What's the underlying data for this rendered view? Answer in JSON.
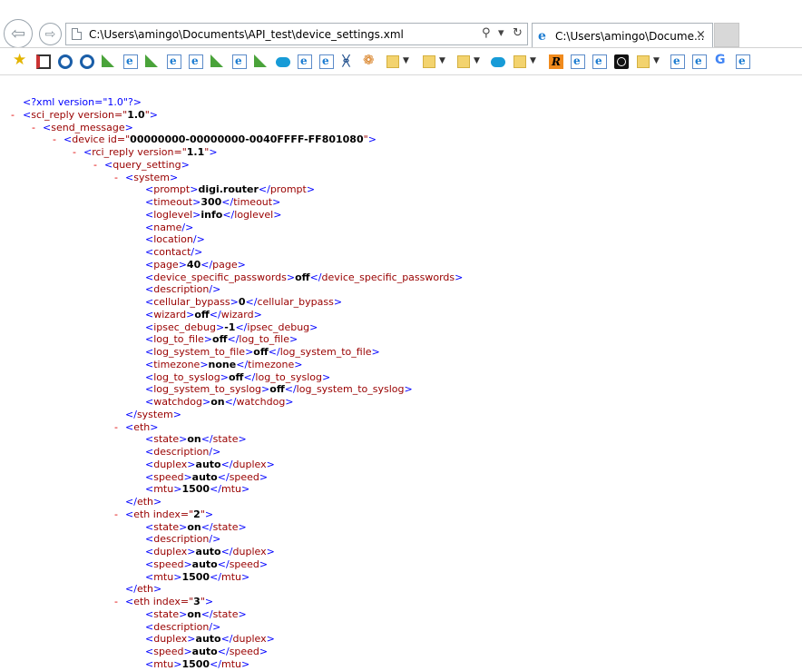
{
  "browser": {
    "address": "C:\\Users\\amingo\\Documents\\API_test\\device_settings.xml",
    "tab_title": "C:\\Users\\amingo\\Docume...",
    "tab_close": "×",
    "search_icon": "⚲",
    "dropdown_icon": "▾",
    "refresh_icon": "↻"
  },
  "favorites_bar": {
    "icons": [
      "star-icon",
      "books-icon",
      "ring-icon",
      "ring-icon",
      "green-flag-icon",
      "ie-page-icon",
      "green-flag-icon",
      "ie-page-icon",
      "ie-page-icon",
      "green-flag-icon",
      "ie-page-icon",
      "green-flag-icon",
      "cloud-icon",
      "ie-page-icon",
      "ie-page-icon",
      "x-logo-icon",
      "hex-logo-icon",
      "folder-icon",
      "folder-icon",
      "folder-icon",
      "cloud-icon",
      "folder-icon",
      "r-logo-icon",
      "ie-page-icon",
      "ie-page-icon",
      "dark-circle-icon",
      "folder-icon",
      "ie-page-icon",
      "ie-page-icon",
      "google-icon",
      "ie-page-icon"
    ],
    "r_label": "R",
    "g_label": "G"
  },
  "xml": {
    "pi": "<?xml version=\"1.0\"?>",
    "sci_reply_attr": "1.0",
    "device_id": "00000000-00000000-0040FFFF-FF801080",
    "rci_reply_attr": "1.1",
    "system": [
      {
        "tag": "prompt",
        "value": "digi.router"
      },
      {
        "tag": "timeout",
        "value": "300"
      },
      {
        "tag": "loglevel",
        "value": "info"
      },
      {
        "tag": "name",
        "value": null
      },
      {
        "tag": "location",
        "value": null
      },
      {
        "tag": "contact",
        "value": null
      },
      {
        "tag": "page",
        "value": "40"
      },
      {
        "tag": "device_specific_passwords",
        "value": "off"
      },
      {
        "tag": "description",
        "value": null
      },
      {
        "tag": "cellular_bypass",
        "value": "0"
      },
      {
        "tag": "wizard",
        "value": "off"
      },
      {
        "tag": "ipsec_debug",
        "value": "-1"
      },
      {
        "tag": "log_to_file",
        "value": "off"
      },
      {
        "tag": "log_system_to_file",
        "value": "off"
      },
      {
        "tag": "timezone",
        "value": "none"
      },
      {
        "tag": "log_to_syslog",
        "value": "off"
      },
      {
        "tag": "log_system_to_syslog",
        "value": "off"
      },
      {
        "tag": "watchdog",
        "value": "on"
      }
    ],
    "eth_blocks": [
      {
        "index": null,
        "children": [
          {
            "tag": "state",
            "value": "on"
          },
          {
            "tag": "description",
            "value": null
          },
          {
            "tag": "duplex",
            "value": "auto"
          },
          {
            "tag": "speed",
            "value": "auto"
          },
          {
            "tag": "mtu",
            "value": "1500"
          }
        ]
      },
      {
        "index": "2",
        "children": [
          {
            "tag": "state",
            "value": "on"
          },
          {
            "tag": "description",
            "value": null
          },
          {
            "tag": "duplex",
            "value": "auto"
          },
          {
            "tag": "speed",
            "value": "auto"
          },
          {
            "tag": "mtu",
            "value": "1500"
          }
        ]
      },
      {
        "index": "3",
        "children": [
          {
            "tag": "state",
            "value": "on"
          },
          {
            "tag": "description",
            "value": null
          },
          {
            "tag": "duplex",
            "value": "auto"
          },
          {
            "tag": "speed",
            "value": "auto"
          },
          {
            "tag": "mtu",
            "value": "1500"
          }
        ]
      }
    ]
  }
}
